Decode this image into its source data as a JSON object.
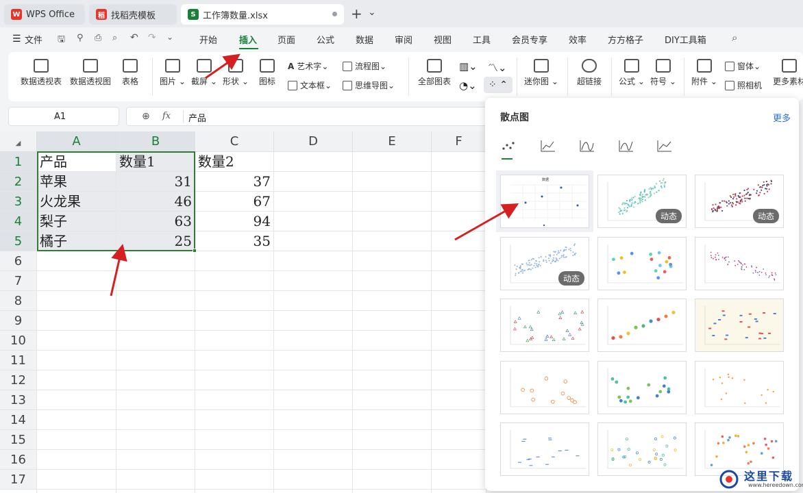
{
  "tabs": [
    {
      "label": "WPS Office",
      "logo": "W",
      "color": "#e8342a"
    },
    {
      "label": "找稻壳模板",
      "logo": "稻",
      "color": "#e8342a"
    },
    {
      "label": "工作簿数量.xlsx",
      "logo": "S",
      "color": "#1a7f37"
    }
  ],
  "tabbar": {
    "new_tab": "+",
    "more": "⌄"
  },
  "menu": {
    "file": "文件",
    "items": [
      "开始",
      "插入",
      "页面",
      "公式",
      "数据",
      "审阅",
      "视图",
      "工具",
      "会员专享",
      "效率",
      "方方格子",
      "DIY工具箱"
    ],
    "active": "插入"
  },
  "ribbon": {
    "pivot_table": "数据透视表",
    "pivot_chart": "数据透视图",
    "table": "表格",
    "picture": "图片",
    "screenshot": "截屏",
    "shape": "形状",
    "icon": "图标",
    "art_text": "艺术字",
    "text_box": "文本框",
    "flowchart": "流程图",
    "mindmap": "思维导图",
    "all_charts": "全部图表",
    "sparkline": "迷你图",
    "hyperlink": "超链接",
    "formula": "公式",
    "symbol": "符号",
    "attachment": "附件",
    "window": "窗体",
    "camera": "照相机",
    "more_material": "更多素材"
  },
  "formula_bar": {
    "cell_ref": "A1",
    "fx": "fx",
    "value": "产品"
  },
  "sheet": {
    "columns": [
      "A",
      "B",
      "C",
      "D",
      "E",
      "F"
    ],
    "rows": [
      "1",
      "2",
      "3",
      "4",
      "5",
      "6",
      "7",
      "8",
      "9",
      "10",
      "11",
      "12",
      "13",
      "14",
      "15",
      "16",
      "17"
    ],
    "cells": [
      [
        "产品",
        "数量1",
        "数量2"
      ],
      [
        "苹果",
        "31",
        "37"
      ],
      [
        "火龙果",
        "46",
        "67"
      ],
      [
        "梨子",
        "63",
        "94"
      ],
      [
        "橘子",
        "25",
        "35"
      ]
    ]
  },
  "scatter_panel": {
    "title": "散点图",
    "more": "更多",
    "tab_icons": [
      "scatter-dots-icon",
      "scatter-line-markers-icon",
      "scatter-smooth-icon",
      "scatter-smooth-markers-icon",
      "scatter-straight-icon"
    ],
    "dynamic_badge": "动态",
    "first_thumb_title": "数据"
  },
  "watermark": {
    "text": "这里下载",
    "url": "www.hereedown.com"
  },
  "colors": {
    "accent": "#1a7f37",
    "selection": "#2e7d32",
    "link": "#2a6fd6",
    "arrow": "#d42020"
  }
}
